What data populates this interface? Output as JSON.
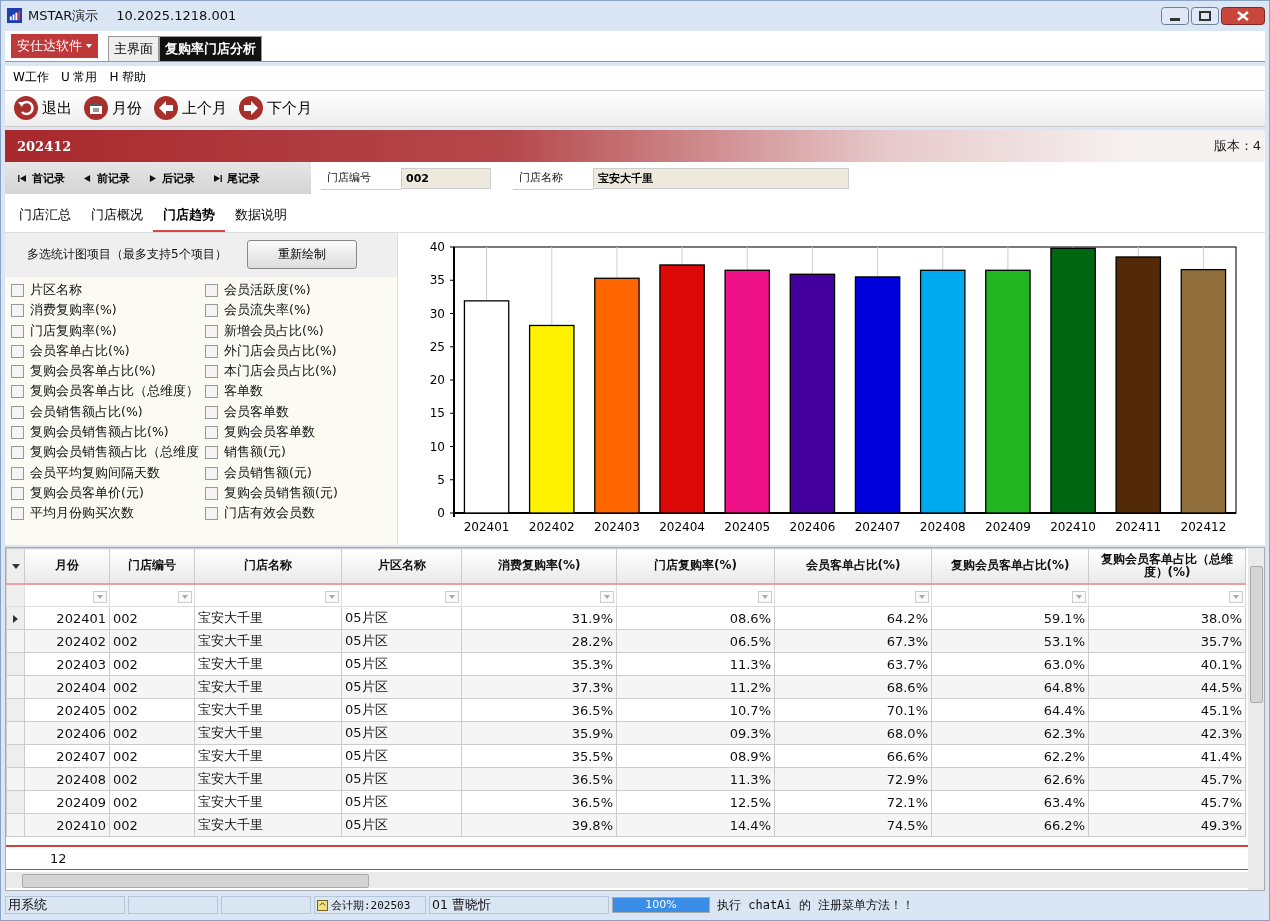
{
  "window": {
    "title": "MSTAR演示",
    "version": "10.2025.1218.001"
  },
  "ribbon": {
    "app_menu": "安仕达软件",
    "tabs": [
      {
        "label": "主界面",
        "selected": false
      },
      {
        "label": "复购率门店分析",
        "selected": true
      }
    ]
  },
  "menu": [
    "W工作",
    "U 常用",
    "H 帮助"
  ],
  "toolbar": [
    {
      "kind": "back",
      "label": "退出"
    },
    {
      "kind": "calendar",
      "label": "月份"
    },
    {
      "kind": "prev",
      "label": "上个月"
    },
    {
      "kind": "next",
      "label": "下个月"
    }
  ],
  "header": {
    "period": "202412",
    "version": "版本：4"
  },
  "record_nav": [
    {
      "kind": "first",
      "label": "首记录"
    },
    {
      "kind": "prev",
      "label": "前记录"
    },
    {
      "kind": "next",
      "label": "后记录"
    },
    {
      "kind": "last",
      "label": "尾记录"
    }
  ],
  "fields": [
    {
      "label": "门店编号",
      "value": "002"
    },
    {
      "label": "门店名称",
      "value": "宝安大千里"
    }
  ],
  "tabs": [
    {
      "label": "门店汇总",
      "selected": false
    },
    {
      "label": "门店概况",
      "selected": false
    },
    {
      "label": "门店趋势",
      "selected": true
    },
    {
      "label": "数据说明",
      "selected": false
    }
  ],
  "options": {
    "hint": "多选统计图项目（最多支持5个项目）",
    "redraw_button": "重新绘制",
    "items": [
      {
        "label": "片区名称",
        "checked": false
      },
      {
        "label": "会员活跃度(%)",
        "checked": false
      },
      {
        "label": "消费复购率(%)",
        "checked": false
      },
      {
        "label": "会员流失率(%)",
        "checked": false
      },
      {
        "label": "门店复购率(%)",
        "checked": false
      },
      {
        "label": "新增会员占比(%)",
        "checked": false
      },
      {
        "label": "会员客单占比(%)",
        "checked": false
      },
      {
        "label": "外门店会员占比(%)",
        "checked": false
      },
      {
        "label": "复购会员客单占比(%)",
        "checked": false
      },
      {
        "label": "本门店会员占比(%)",
        "checked": false
      },
      {
        "label": "复购会员客单占比（总维度）",
        "checked": false
      },
      {
        "label": "客单数",
        "checked": false
      },
      {
        "label": "会员销售额占比(%)",
        "checked": false
      },
      {
        "label": "会员客单数",
        "checked": false
      },
      {
        "label": "复购会员销售额占比(%)",
        "checked": false
      },
      {
        "label": "复购会员客单数",
        "checked": false
      },
      {
        "label": "复购会员销售额占比（总维度",
        "checked": false
      },
      {
        "label": "销售额(元)",
        "checked": false
      },
      {
        "label": "会员平均复购间隔天数",
        "checked": false
      },
      {
        "label": "会员销售额(元)",
        "checked": false
      },
      {
        "label": "复购会员客单价(元)",
        "checked": false
      },
      {
        "label": "复购会员销售额(元)",
        "checked": false
      },
      {
        "label": "平均月份购买次数",
        "checked": false
      },
      {
        "label": "门店有效会员数",
        "checked": false
      }
    ]
  },
  "chart": {
    "bars": [
      {
        "color": "#ffffff"
      },
      {
        "color": "#fff200"
      },
      {
        "color": "#ff6600"
      },
      {
        "color": "#dd0808"
      },
      {
        "color": "#ee1188"
      },
      {
        "color": "#44009f"
      },
      {
        "color": "#0000dd"
      },
      {
        "color": "#00aaee"
      },
      {
        "color": "#22b522"
      },
      {
        "color": "#006611"
      },
      {
        "color": "#522a08"
      },
      {
        "color": "#8f6e3c"
      }
    ],
    "chart_data": {
      "type": "bar",
      "grid": true,
      "categories": [
        "202401",
        "202402",
        "202403",
        "202404",
        "202405",
        "202406",
        "202407",
        "202408",
        "202409",
        "202410",
        "202411",
        "202412"
      ],
      "series": [
        {
          "color": "#000000",
          "values": [
            31.9,
            28.2,
            35.3,
            37.3,
            36.5,
            35.9,
            35.5,
            36.5,
            36.5,
            39.8,
            38.5,
            36.6
          ]
        }
      ],
      "ylim": [
        0,
        40
      ],
      "yticks": [
        0,
        5,
        10,
        15,
        20,
        25,
        30,
        35,
        40
      ]
    }
  },
  "table": {
    "columns": [
      "月份",
      "门店编号",
      "门店名称",
      "片区名称",
      "消费复购率(%)",
      "门店复购率(%)",
      "会员客单占比(%)",
      "复购会员客单占比(%)",
      "复购会员客单占比（总维度）(%)"
    ],
    "rows": [
      {
        "selected": true,
        "cells": [
          "202401",
          "002",
          "宝安大千里",
          "05片区",
          "31.9%",
          "08.6%",
          "64.2%",
          "59.1%",
          "38.0%"
        ]
      },
      {
        "selected": false,
        "cells": [
          "202402",
          "002",
          "宝安大千里",
          "05片区",
          "28.2%",
          "06.5%",
          "67.3%",
          "53.1%",
          "35.7%"
        ]
      },
      {
        "selected": false,
        "cells": [
          "202403",
          "002",
          "宝安大千里",
          "05片区",
          "35.3%",
          "11.3%",
          "63.7%",
          "63.0%",
          "40.1%"
        ]
      },
      {
        "selected": false,
        "cells": [
          "202404",
          "002",
          "宝安大千里",
          "05片区",
          "37.3%",
          "11.2%",
          "68.6%",
          "64.8%",
          "44.5%"
        ]
      },
      {
        "selected": false,
        "cells": [
          "202405",
          "002",
          "宝安大千里",
          "05片区",
          "36.5%",
          "10.7%",
          "70.1%",
          "64.4%",
          "45.1%"
        ]
      },
      {
        "selected": false,
        "cells": [
          "202406",
          "002",
          "宝安大千里",
          "05片区",
          "35.9%",
          "09.3%",
          "68.0%",
          "62.3%",
          "42.3%"
        ]
      },
      {
        "selected": false,
        "cells": [
          "202407",
          "002",
          "宝安大千里",
          "05片区",
          "35.5%",
          "08.9%",
          "66.6%",
          "62.2%",
          "41.4%"
        ]
      },
      {
        "selected": false,
        "cells": [
          "202408",
          "002",
          "宝安大千里",
          "05片区",
          "36.5%",
          "11.3%",
          "72.9%",
          "62.6%",
          "45.7%"
        ]
      },
      {
        "selected": false,
        "cells": [
          "202409",
          "002",
          "宝安大千里",
          "05片区",
          "36.5%",
          "12.5%",
          "72.1%",
          "63.4%",
          "45.7%"
        ]
      },
      {
        "selected": false,
        "cells": [
          "202410",
          "002",
          "宝安大千里",
          "05片区",
          "39.8%",
          "14.4%",
          "74.5%",
          "66.2%",
          "49.3%"
        ]
      }
    ],
    "footer_count": "12"
  },
  "status_bar": {
    "system": "用系统",
    "period": "会计期:202503",
    "user": "01 曹晓忻",
    "progress": {
      "level": 1,
      "reading": "100%"
    },
    "message": "执行 chatAi 的 注册菜单方法！！"
  }
}
